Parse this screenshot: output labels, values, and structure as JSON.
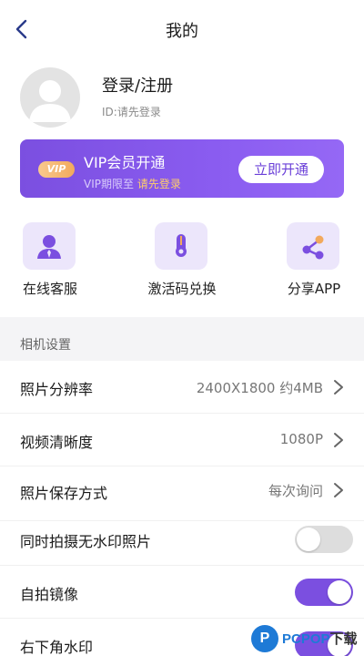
{
  "header": {
    "title": "我的"
  },
  "profile": {
    "login_text": "登录/注册",
    "id_text": "ID:请先登录"
  },
  "vip": {
    "badge": "VIP",
    "title": "VIP会员开通",
    "expiry_prefix": "VIP期限至",
    "expiry_value": "请先登录",
    "button": "立即开通"
  },
  "quick_actions": [
    {
      "label": "在线客服",
      "icon": "customer-service-icon"
    },
    {
      "label": "激活码兑换",
      "icon": "key-icon"
    },
    {
      "label": "分享APP",
      "icon": "share-icon"
    }
  ],
  "camera_settings": {
    "title": "相机设置",
    "rows": [
      {
        "label": "照片分辨率",
        "value": "2400X1800 约4MB"
      },
      {
        "label": "视频清晰度",
        "value": "1080P"
      },
      {
        "label": "照片保存方式",
        "value": "每次询问"
      }
    ],
    "toggles": [
      {
        "label": "同时拍摄无水印照片",
        "on": false
      },
      {
        "label": "自拍镜像",
        "on": true
      },
      {
        "label": "右下角水印",
        "on": true
      }
    ]
  },
  "colors": {
    "accent": "#7b4fe0",
    "vip_highlight": "#ffcf6b",
    "section_bg": "#f4f4f6"
  },
  "watermark": {
    "logo": "P",
    "text": "PCPOP",
    "suffix": "下载"
  }
}
